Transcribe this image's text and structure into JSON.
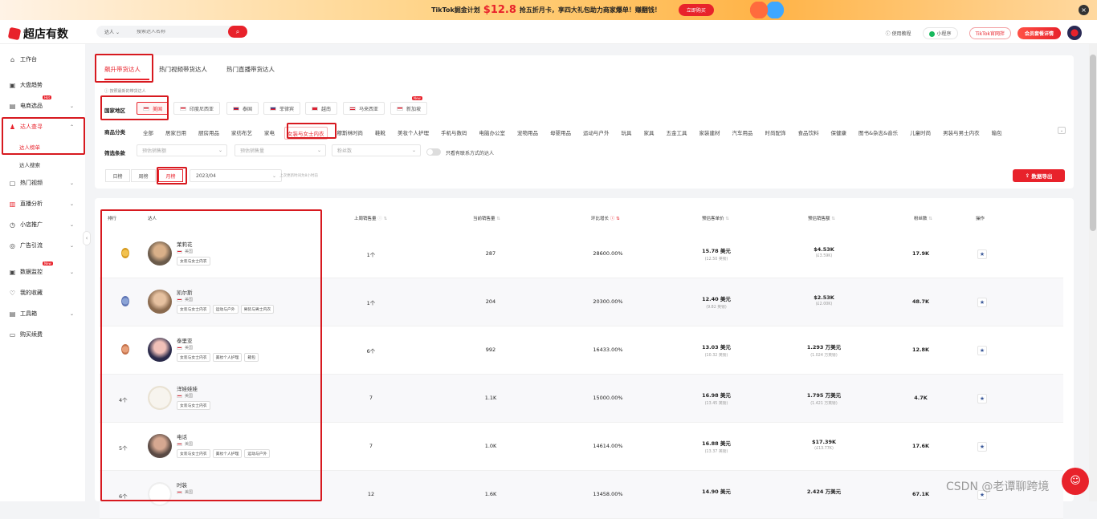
{
  "banner": {
    "prefix": "TikTok掘金计划",
    "price": "$12.8",
    "suffix": "抢五折月卡，享四大礼包助力商家爆单！赚翻钱！",
    "button": "立即购买",
    "close": "×"
  },
  "header": {
    "logo": "超店有数",
    "search_type": "达人",
    "search_placeholder": "搜索达人名称",
    "tutorial": "使用教程",
    "mini_program": "小程序",
    "tiktok_link": "TikTok官网拌",
    "vip": "会员套餐详情"
  },
  "sidebar": {
    "items": [
      {
        "label": "工作台",
        "icon": "⌂"
      },
      {
        "label": "大盘趋势",
        "icon": "▣"
      },
      {
        "label": "电商选品",
        "icon": "▤",
        "hot": "Hot"
      },
      {
        "label": "达人查寻",
        "icon": "♟"
      },
      {
        "label": "达人榜单",
        "icon": ""
      },
      {
        "label": "达人搜索",
        "icon": ""
      },
      {
        "label": "热门视频",
        "icon": "▢"
      },
      {
        "label": "直播分析",
        "icon": "▥"
      },
      {
        "label": "小店推广",
        "icon": "◷"
      },
      {
        "label": "广告引流",
        "icon": "◎"
      },
      {
        "label": "数据监控",
        "icon": "▣",
        "hot": "New"
      },
      {
        "label": "我的收藏",
        "icon": "♡"
      },
      {
        "label": "工具箱",
        "icon": "▤"
      },
      {
        "label": "购买续费",
        "icon": "▭"
      }
    ]
  },
  "tabs": [
    "飙升带货达人",
    "热门视频带货达人",
    "热门直播带货达人"
  ],
  "hint": "按照最新的带货达人",
  "filters": {
    "country_label": "国家地区",
    "countries": [
      "美国",
      "印度尼西亚",
      "泰国",
      "菲律宾",
      "越南",
      "马来西亚",
      "新加坡"
    ],
    "country_new": "New",
    "category_label": "商品分类",
    "categories": [
      "全部",
      "居家日用",
      "厨房用品",
      "家纺布艺",
      "家电",
      "女装与女士内衣",
      "穆斯林时尚",
      "鞋靴",
      "美妆个人护理",
      "手机与数码",
      "电脑办公室",
      "宠物用品",
      "母婴用品",
      "运动与户外",
      "玩具",
      "家具",
      "五金工具",
      "家装建材",
      "汽车用品",
      "时尚配饰",
      "食品饮料",
      "保健康",
      "图书&杂志&音乐",
      "儿童时尚",
      "男装与男士内衣",
      "箱包"
    ],
    "filter_label": "筛选条款",
    "selects": [
      "预估销售额",
      "预估销售量",
      "粉丝数"
    ],
    "toggle_label": "只看有联系方式的达人",
    "periods": [
      "日榜",
      "周榜",
      "月榜"
    ],
    "month": "2023/04",
    "update": "上次更新时间为8小时前",
    "export": "数据导出"
  },
  "table": {
    "headers": [
      "排行",
      "达人",
      "上周销售量",
      "当前销售量",
      "环比增长",
      "预估客单价",
      "预估销售额",
      "粉丝数",
      "操作"
    ],
    "rows": [
      {
        "rank": "",
        "medal": "gold",
        "name": "茉莉花",
        "country": "美国",
        "tags": [
          "女装与女士内衣"
        ],
        "last": "1个",
        "current": "287",
        "growth": "28600.00%",
        "price": "15.78 美元",
        "price_sub": "(12.50 英镑)",
        "sales": "$4.53K",
        "sales_sub": "(£3.59K)",
        "fans": "17.9K"
      },
      {
        "rank": "",
        "medal": "silver",
        "name": "凯尔斯",
        "country": "美国",
        "tags": [
          "女装与女士内衣",
          "运动与户外",
          "男装与男士内衣"
        ],
        "last": "1个",
        "current": "204",
        "growth": "20300.00%",
        "price": "12.40 美元",
        "price_sub": "(9.82 英镑)",
        "sales": "$2.53K",
        "sales_sub": "(£2.00K)",
        "fans": "48.7K"
      },
      {
        "rank": "",
        "medal": "bronze",
        "name": "泰里亚",
        "country": "美国",
        "tags": [
          "女装与女士内衣",
          "美妆个人护理",
          "箱包"
        ],
        "last": "6个",
        "current": "992",
        "growth": "16433.00%",
        "price": "13.03 美元",
        "price_sub": "(10.32 英镑)",
        "sales": "1.293 万美元",
        "sales_sub": "(1.024 万英镑)",
        "fans": "12.8K"
      },
      {
        "rank": "4个",
        "medal": "",
        "name": "洋娃娃娃",
        "country": "美国",
        "tags": [
          "女装与女士内衣"
        ],
        "last": "7",
        "current": "1.1K",
        "growth": "15000.00%",
        "price": "16.98 美元",
        "price_sub": "(13.45 英镑)",
        "sales": "1.795 万美元",
        "sales_sub": "(1.421 万英镑)",
        "fans": "4.7K"
      },
      {
        "rank": "5个",
        "medal": "",
        "name": "电话",
        "country": "美国",
        "tags": [
          "女装与女士内衣",
          "美妆个人护理",
          "运动与户外"
        ],
        "last": "7",
        "current": "1.0K",
        "growth": "14614.00%",
        "price": "16.88 美元",
        "price_sub": "(13.37 英镑)",
        "sales": "$17.39K",
        "sales_sub": "(£13.77K)",
        "fans": "17.6K"
      },
      {
        "rank": "6个",
        "medal": "",
        "name": "时装",
        "country": "美国",
        "tags": [],
        "last": "12",
        "current": "1.6K",
        "growth": "13458.00%",
        "price": "14.90 美元",
        "price_sub": "",
        "sales": "2.424 万美元",
        "sales_sub": "",
        "fans": "67.1K"
      }
    ]
  },
  "watermark": "CSDN @老谭聊跨境",
  "colors": {
    "accent": "#e8222b",
    "annotation": "#d7191f"
  }
}
